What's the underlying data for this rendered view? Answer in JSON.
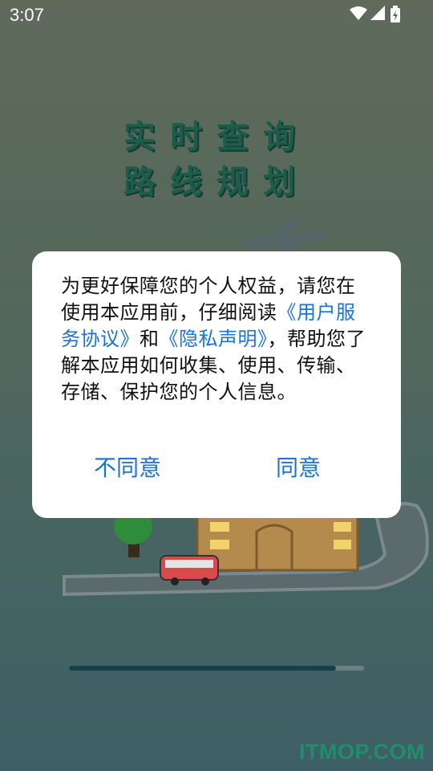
{
  "status_bar": {
    "time": "3:07"
  },
  "splash": {
    "headline_1": "实时查询",
    "headline_2": "路线规划"
  },
  "dialog": {
    "text_1": "为更好保障您的个人权益，请您在使用本应用前，仔细阅读",
    "link_agreement": "《用户服务协议》",
    "text_2": "和",
    "link_privacy": "《隐私声明》",
    "text_3": "，帮助您了解本应用如何收集、使用、传输、存储、保护您的个人信息。",
    "disagree_label": "不同意",
    "agree_label": "同意"
  },
  "loading": {
    "progress": 0.905
  },
  "watermark": "ITMOP.COM",
  "colors": {
    "link": "#1a73d9",
    "headline": "#1c5c4a",
    "watermark": "#1f8e6a"
  }
}
